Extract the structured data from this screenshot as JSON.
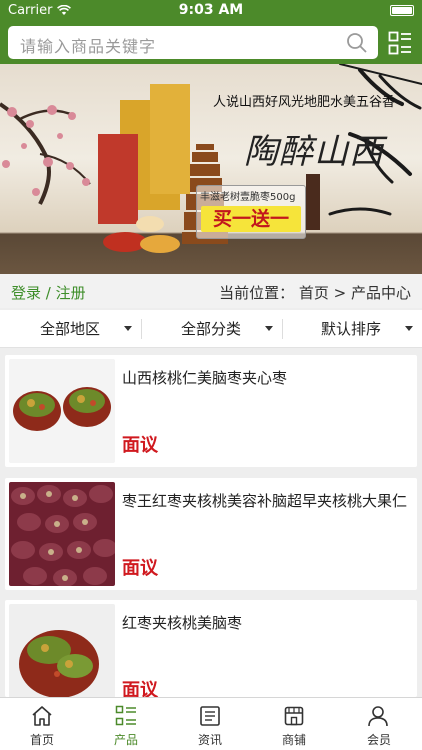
{
  "status_bar": {
    "carrier": "Carrier",
    "time": "9:03 AM"
  },
  "search": {
    "placeholder": "请输入商品关键字"
  },
  "banner": {
    "slogan": "人说山西好风光地肥水美五谷香",
    "brand": "陶醉山西",
    "product_name": "丰滋老树壹脆枣500g",
    "promo": "买一送一"
  },
  "breadcrumb": {
    "login": "登录 / 注册",
    "location": "当前位置：  首页  >  产品中心"
  },
  "filters": [
    "全部地区",
    "全部分类",
    "默认排序"
  ],
  "products": [
    {
      "title": "山西核桃仁美脑枣夹心枣",
      "price": "面议"
    },
    {
      "title": "枣王红枣夹核桃美容补脑超早夹核桃大果仁",
      "price": "面议"
    },
    {
      "title": "红枣夹核桃美脑枣",
      "price": "面议"
    }
  ],
  "tabs": [
    {
      "label": "首页",
      "icon": "home-icon",
      "active": false
    },
    {
      "label": "产品",
      "icon": "grid-list-icon",
      "active": true
    },
    {
      "label": "资讯",
      "icon": "news-icon",
      "active": false
    },
    {
      "label": "商铺",
      "icon": "store-icon",
      "active": false
    },
    {
      "label": "会员",
      "icon": "user-icon",
      "active": false
    }
  ],
  "colors": {
    "brand_green": "#4c8a2a",
    "price_red": "#d0191f"
  }
}
